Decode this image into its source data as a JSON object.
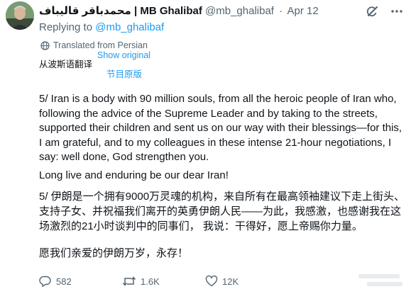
{
  "author": {
    "display_name": "محمدباقر قالیباف | MB Ghalibaf",
    "handle": "@mb_ghalibaf",
    "separator": "·",
    "date": "Apr 12"
  },
  "reply": {
    "prefix": "Replying to",
    "target": "@mb_ghalibaf"
  },
  "translation": {
    "translated_from": "Translated from Persian",
    "show_original": "Show original",
    "cn_translated_from": "从波斯语翻译",
    "cn_show_original": "节目原版"
  },
  "body_en": {
    "lines": [
      "5/ Iran is a body with 90 million souls, from all the heroic people of Iran who,",
      "following the advice of the Supreme Leader and by taking to the streets,",
      "supported their children and sent us on our way with their blessings—for this,",
      "I am grateful, and to my colleagues in these intense 21-hour negotiations, I",
      "say: well done, God strengthen you."
    ],
    "closing": "Long live and enduring be our dear Iran!"
  },
  "body_cn": {
    "lines": [
      "5/ 伊朗是一个拥有9000万灵魂的机构，来自所有在最高领袖建议下走上街头、",
      "支持子女、并祝福我们离开的英勇伊朗人民——为此，我感激，也感谢我在这",
      "场激烈的21小时谈判中的同事们，  我说：干得好，愿上帝赐你力量。"
    ],
    "closing": "愿我们亲爱的伊朗万岁，永存！"
  },
  "actions": {
    "replies": "582",
    "reposts": "1.6K",
    "likes": "12K"
  },
  "icons": {
    "top": [
      "grok-icon",
      "more-icon"
    ],
    "actions": [
      "reply-icon",
      "repost-icon",
      "like-icon"
    ]
  },
  "colors": {
    "link": "#1d9bf0",
    "muted": "#536471",
    "text": "#0f1419"
  }
}
